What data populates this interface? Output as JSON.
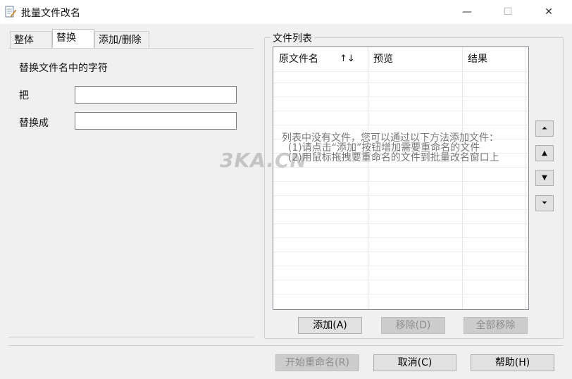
{
  "window": {
    "title": "批量文件改名",
    "minimize_glyph": "—",
    "maximize_glyph": "☐",
    "close_glyph": "✕",
    "icon": "document-edit-icon"
  },
  "tabs": [
    {
      "label": "整体",
      "active": false
    },
    {
      "label": "替换",
      "active": true
    },
    {
      "label": "添加/删除",
      "active": false
    }
  ],
  "replace_panel": {
    "heading": "替换文件名中的字符",
    "from_label": "把",
    "from_value": "",
    "to_label": "替换成",
    "to_value": ""
  },
  "file_list": {
    "group_label": "文件列表",
    "columns": [
      "原文件名",
      "预览",
      "结果"
    ],
    "sort_arrows": "↑↓",
    "empty_message": "列表中没有文件，您可以通过以下方法添加文件：\n  (1)请点击“添加”按钮增加需要重命名的文件\n  (2)用鼠标拖拽要重命名的文件到批量改名窗口上",
    "add_button": "添加(A)",
    "remove_button": "移除(D)",
    "remove_all_button": "全部移除"
  },
  "side_buttons": {
    "top_glyph": "⏶",
    "up_glyph": "▲",
    "down_glyph": "▼",
    "bottom_glyph": "⏷"
  },
  "footer": {
    "start_button": "开始重命名(R)",
    "cancel_button": "取消(C)",
    "help_button": "帮助(H)"
  },
  "watermark": "3KA.CN"
}
